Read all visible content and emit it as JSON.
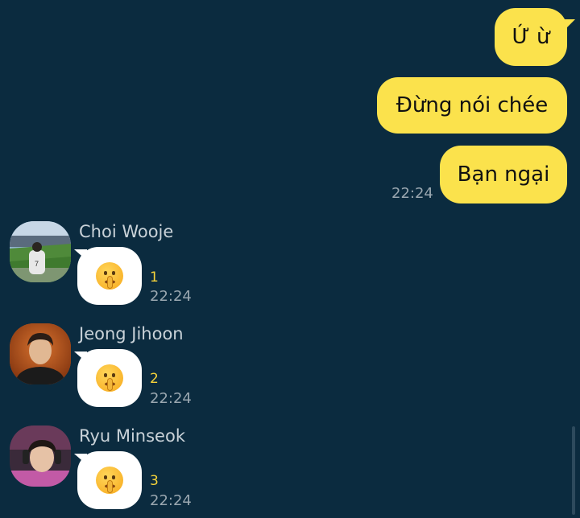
{
  "outgoing": [
    {
      "text": "Ứ ừ"
    },
    {
      "text": "Đừng nói chée"
    },
    {
      "text": "Bạn ngại",
      "time": "22:24"
    }
  ],
  "incoming": [
    {
      "sender": "Choi Wooje",
      "emoji": "shushing-face-emoji",
      "unread": "1",
      "time": "22:24"
    },
    {
      "sender": "Jeong Jihoon",
      "emoji": "shushing-face-emoji",
      "unread": "2",
      "time": "22:24"
    },
    {
      "sender": "Ryu Minseok",
      "emoji": "shushing-face-emoji",
      "unread": "3",
      "time": "22:24"
    }
  ],
  "colors": {
    "background": "#0b2b3f",
    "outgoing_bubble": "#fbe24c",
    "incoming_bubble": "#ffffff",
    "unread_count": "#f6d33a"
  }
}
